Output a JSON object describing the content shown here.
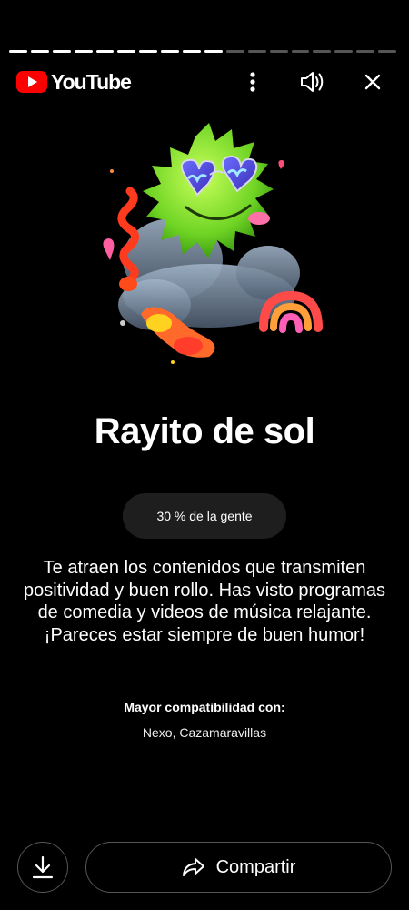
{
  "story": {
    "progress_segments_total": 18,
    "progress_segments_done": 10
  },
  "header": {
    "brand": "YouTube",
    "icons": [
      "youtube-logo-icon",
      "more-vert-icon",
      "volume-icon",
      "close-icon"
    ]
  },
  "card": {
    "title": "Rayito de sol",
    "badge": "30 % de la gente",
    "description": "Te atraen los contenidos que transmiten positividad y buen rollo. Has visto programas de comedia y videos de música relajante. ¡Pareces estar siempre de buen humor!",
    "compat_label": "Mayor compatibilidad con:",
    "compat_value": "Nexo, Cazamaravillas"
  },
  "footer": {
    "share_label": "Compartir",
    "icons": [
      "download-icon",
      "share-icon"
    ]
  },
  "colors": {
    "background": "#000000",
    "brand_red": "#ff0000",
    "badge_bg": "#1e1e1e",
    "character_green": "#7ddf2a"
  }
}
